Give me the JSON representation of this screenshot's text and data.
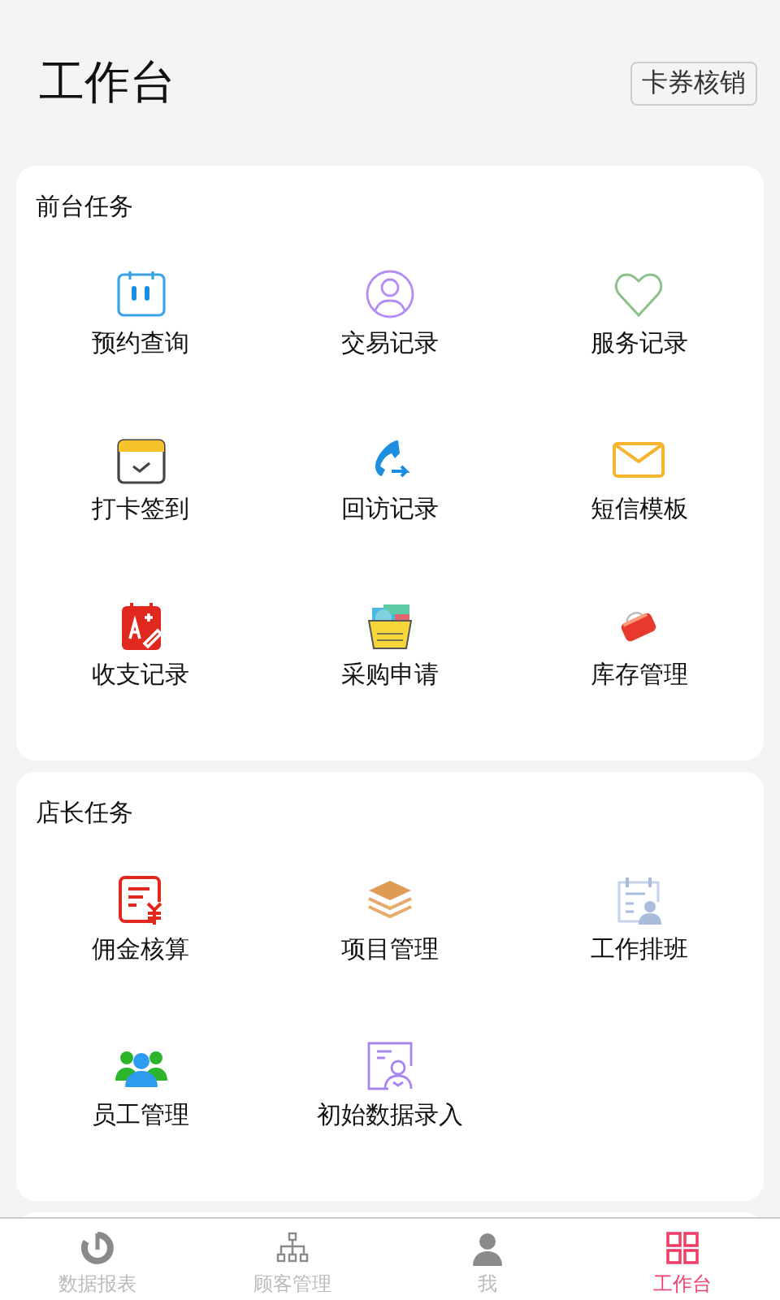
{
  "header": {
    "title": "工作台",
    "action": "卡券核销"
  },
  "sections": [
    {
      "title": "前台任务",
      "items": [
        {
          "label": "预约查询"
        },
        {
          "label": "交易记录"
        },
        {
          "label": "服务记录"
        },
        {
          "label": "打卡签到"
        },
        {
          "label": "回访记录"
        },
        {
          "label": "短信模板"
        },
        {
          "label": "收支记录"
        },
        {
          "label": "采购申请"
        },
        {
          "label": "库存管理"
        }
      ]
    },
    {
      "title": "店长任务",
      "items": [
        {
          "label": "佣金核算"
        },
        {
          "label": "项目管理"
        },
        {
          "label": "工作排班"
        },
        {
          "label": "员工管理"
        },
        {
          "label": "初始数据录入"
        }
      ]
    }
  ],
  "tab_bar": [
    {
      "label": "数据报表",
      "selected": false
    },
    {
      "label": "顾客管理",
      "selected": false
    },
    {
      "label": "我",
      "selected": false
    },
    {
      "label": "工作台",
      "selected": true
    }
  ]
}
